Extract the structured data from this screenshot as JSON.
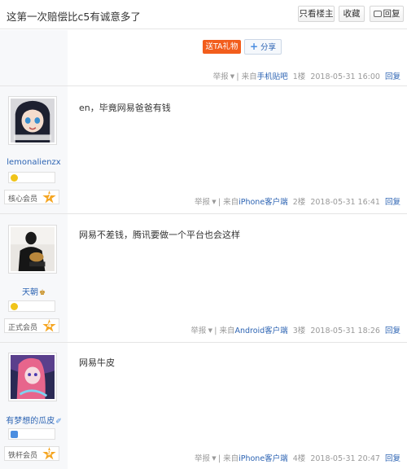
{
  "header": {
    "title": "这第一次赔偿比c5有诚意多了",
    "only_lz_label": "只看楼主",
    "favorite_label": "收藏",
    "reply_label": "回复"
  },
  "first_post": {
    "gift_label": "送TA礼物",
    "share_label": "分享",
    "report": "举报",
    "from_prefix": "来自",
    "source": "手机贴吧",
    "floor": "1楼",
    "time": "2018-05-31 16:00",
    "reply": "回复"
  },
  "posts": [
    {
      "username": "lemonalienzx",
      "badge_icon": "gold-coin-icon",
      "badge_color": "#f0c419",
      "level_name": "核心会员",
      "level_num": "7",
      "content": "en，毕竟网易爸爸有钱",
      "report": "举报",
      "from_prefix": "来自",
      "source": "iPhone客户端",
      "floor": "2楼",
      "time": "2018-05-31 16:41",
      "reply": "回复"
    },
    {
      "username": "天朝",
      "badge_icon": "gold-coin-icon",
      "badge_color": "#f0c419",
      "level_name": "正式会员",
      "level_num": "4",
      "content": "网易不差钱，腾讯要做一个平台也会这样",
      "report": "举报",
      "from_prefix": "来自",
      "source": "Android客户端",
      "floor": "3楼",
      "time": "2018-05-31 18:26",
      "reply": "回复"
    },
    {
      "username": "有梦想的瓜皮",
      "badge_icon": "blue-member-icon",
      "badge_color": "#4a8de0",
      "level_name": "铁杆会员",
      "level_num": "9",
      "content": "网易牛皮",
      "report": "举报",
      "from_prefix": "来自",
      "source": "iPhone客户端",
      "floor": "4楼",
      "time": "2018-05-31 20:47",
      "reply": "回复"
    }
  ],
  "colors": {
    "link": "#2d64b3",
    "gift": "#f25d1c",
    "star": "#f5a623"
  }
}
